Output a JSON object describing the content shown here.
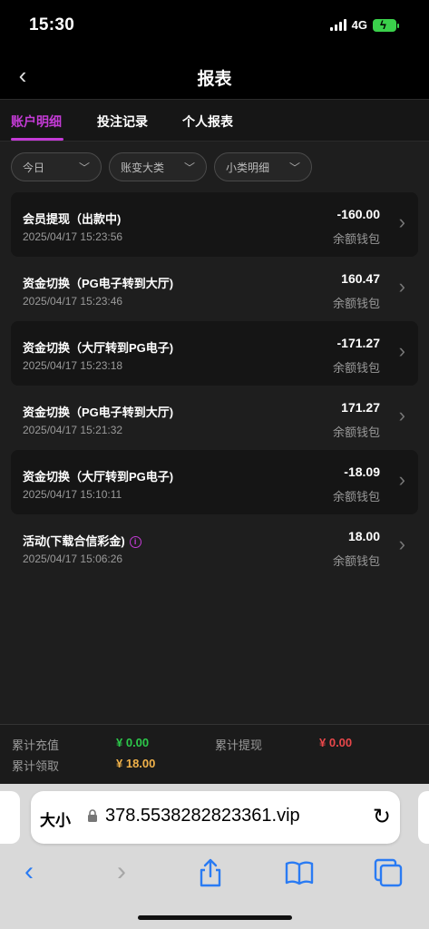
{
  "status": {
    "time": "15:30",
    "network": "4G"
  },
  "nav": {
    "title": "报表"
  },
  "tabs": [
    "账户明细",
    "投注记录",
    "个人报表"
  ],
  "filters": [
    "今日",
    "账变大类",
    "小类明细"
  ],
  "rows": [
    {
      "title": "会员提现（出款中)",
      "date": "2025/04/17 15:23:56",
      "amount": "-160.00",
      "wallet": "余额钱包"
    },
    {
      "title": "资金切换（PG电子转到大厅)",
      "date": "2025/04/17 15:23:46",
      "amount": "160.47",
      "wallet": "余额钱包"
    },
    {
      "title": "资金切换（大厅转到PG电子)",
      "date": "2025/04/17 15:23:18",
      "amount": "-171.27",
      "wallet": "余额钱包"
    },
    {
      "title": "资金切换（PG电子转到大厅)",
      "date": "2025/04/17 15:21:32",
      "amount": "171.27",
      "wallet": "余额钱包"
    },
    {
      "title": "资金切换（大厅转到PG电子)",
      "date": "2025/04/17 15:10:11",
      "amount": "-18.09",
      "wallet": "余额钱包"
    },
    {
      "title": "活动(下载合信彩金)",
      "date": "2025/04/17 15:06:26",
      "amount": "18.00",
      "wallet": "余额钱包"
    }
  ],
  "summary": {
    "recharge_label": "累计充值",
    "recharge_value": "¥ 0.00",
    "withdraw_label": "累计提现",
    "withdraw_value": "¥ 0.00",
    "claim_label": "累计领取",
    "claim_value": "¥ 18.00"
  },
  "browser": {
    "aa": "大小",
    "url": "378.5538282823361.vip"
  },
  "colors": {
    "accent": "#c43bd6",
    "green": "#2cc84a",
    "red": "#e8474a",
    "orange": "#f1b24a",
    "link": "#2a7bf3"
  }
}
